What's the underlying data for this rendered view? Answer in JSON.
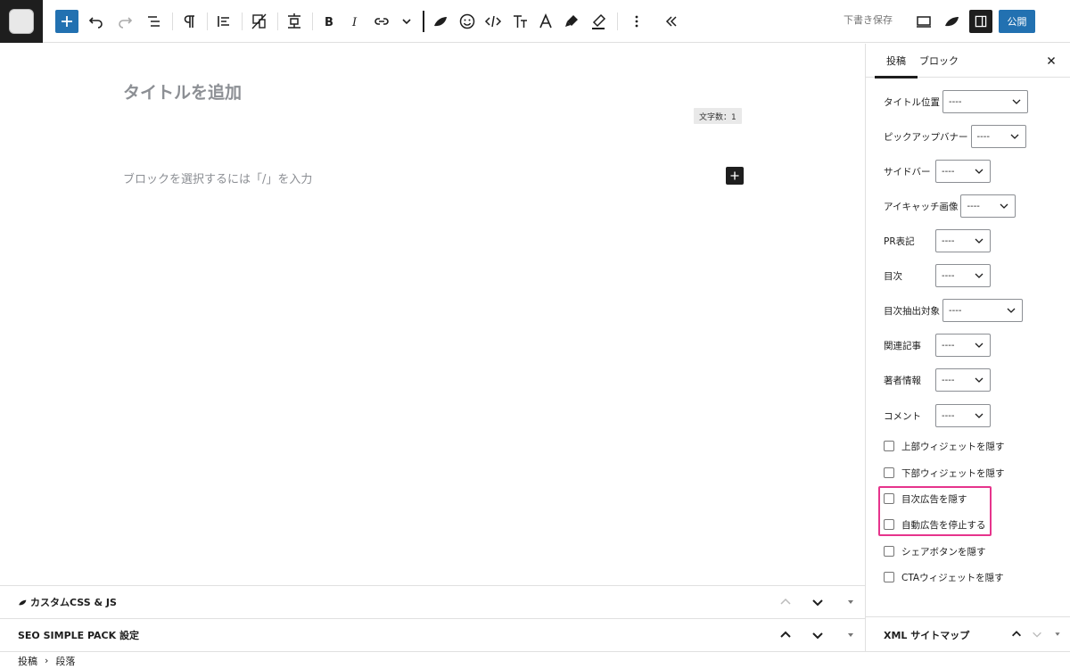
{
  "toolbar": {
    "draft_label": "下書き保存",
    "publish_label": "公開",
    "accent": "#2271b1"
  },
  "editor": {
    "title_placeholder": "タイトルを追加",
    "word_count": "文字数：1",
    "block_placeholder": "ブロックを選択するには「/」を入力"
  },
  "metaboxes": [
    {
      "label": "カスタムCSS & JS"
    },
    {
      "label": "SEO SIMPLE PACK 設定"
    }
  ],
  "breadcrumb": {
    "items": [
      "投稿",
      "段落"
    ],
    "separator": "›"
  },
  "sidebar": {
    "tabs": [
      "投稿",
      "ブロック"
    ],
    "fields": [
      {
        "label": "タイトル位置",
        "value": "----"
      },
      {
        "label": "ピックアップバナー",
        "value": "----"
      },
      {
        "label": "サイドバー",
        "value": "----"
      },
      {
        "label": "アイキャッチ画像",
        "value": "----"
      },
      {
        "label": "PR表記",
        "value": "----"
      },
      {
        "label": "目次",
        "value": "----"
      },
      {
        "label": "目次抽出対象",
        "value": "----"
      },
      {
        "label": "関連記事",
        "value": "----"
      },
      {
        "label": "著者情報",
        "value": "----"
      },
      {
        "label": "コメント",
        "value": "----"
      }
    ],
    "checks": [
      {
        "label": "上部ウィジェットを隠す",
        "checked": false
      },
      {
        "label": "下部ウィジェットを隠す",
        "checked": false
      },
      {
        "label": "目次広告を隠す",
        "checked": false
      },
      {
        "label": "自動広告を停止する",
        "checked": false
      },
      {
        "label": "シェアボタンを隠す",
        "checked": false
      },
      {
        "label": "CTAウィジェットを隠す",
        "checked": false
      }
    ],
    "bottom_panel": "XML サイトマップ",
    "highlight_color": "#e6348c"
  }
}
